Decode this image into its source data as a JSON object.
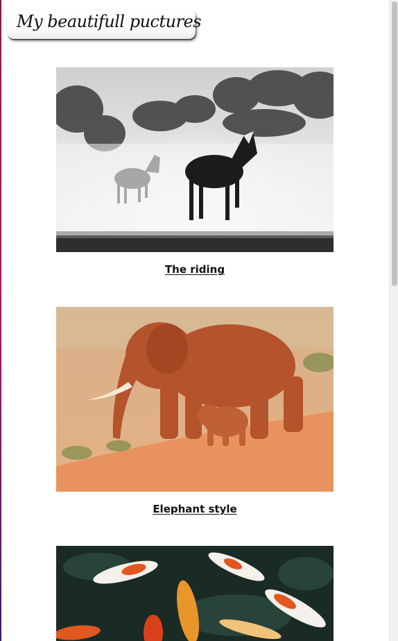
{
  "header": {
    "title": "My beautifull puctures"
  },
  "gallery": {
    "items": [
      {
        "caption": "The riding",
        "image": "horses-running-in-dust"
      },
      {
        "caption": "Elephant style",
        "image": "elephant-with-calf"
      },
      {
        "caption": "",
        "image": "koi-fish-pond"
      }
    ]
  },
  "colors": {
    "background": "#ffffff",
    "caption_text": "#111111",
    "elephant_tone": "#b5532c",
    "koi_orange": "#e2561f"
  }
}
